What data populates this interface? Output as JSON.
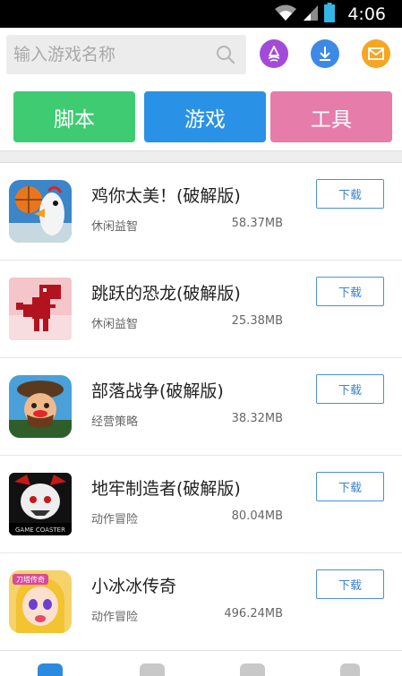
{
  "status_bar": {
    "time": "4:06"
  },
  "search": {
    "placeholder": "输入游戏名称"
  },
  "header_icons": [
    {
      "name": "rocket-icon",
      "color": "#a24bd8"
    },
    {
      "name": "download-icon",
      "color": "#3d8ae6"
    },
    {
      "name": "mail-icon",
      "color": "#f5a623"
    }
  ],
  "categories": [
    {
      "label": "脚本",
      "color": "#3ecb72"
    },
    {
      "label": "游戏",
      "color": "#2992e6"
    },
    {
      "label": "工具",
      "color": "#e57ca9"
    }
  ],
  "apps": [
    {
      "name": "鸡你太美！(破解版)",
      "category": "休闲益智",
      "size": "58.37MB",
      "download_label": "下载",
      "icon": "basketball-chicken-icon"
    },
    {
      "name": "跳跃的恐龙(破解版)",
      "category": "休闲益智",
      "size": "25.38MB",
      "download_label": "下载",
      "icon": "pixel-dinosaur-icon"
    },
    {
      "name": "部落战争(破解版)",
      "category": "经营策略",
      "size": "38.32MB",
      "download_label": "下载",
      "icon": "tribe-warrior-icon"
    },
    {
      "name": "地牢制造者(破解版)",
      "category": "动作冒险",
      "size": "80.04MB",
      "download_label": "下载",
      "icon": "dungeon-maker-icon",
      "icon_text": "GAME COASTER"
    },
    {
      "name": "小冰冰传奇",
      "category": "动作冒险",
      "size": "496.24MB",
      "download_label": "下载",
      "icon": "anime-girl-icon",
      "icon_text": "刀塔传奇"
    }
  ]
}
